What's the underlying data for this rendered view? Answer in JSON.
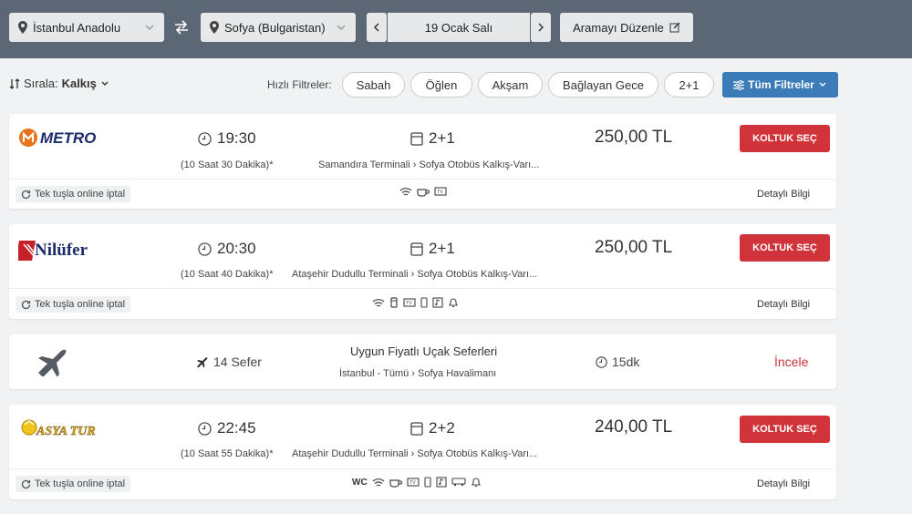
{
  "search": {
    "from": "İstanbul Anadolu",
    "to": "Sofya (Bulgaristan)",
    "date": "19 Ocak Salı",
    "edit_label": "Aramayı Düzenle"
  },
  "filters": {
    "sort_prefix": "Sırala:",
    "sort_value": "Kalkış",
    "quick_label": "Hızlı Filtreler:",
    "pills": [
      "Sabah",
      "Öğlen",
      "Akşam",
      "Bağlayan Gece",
      "2+1"
    ],
    "all_filters": "Tüm Filtreler"
  },
  "trips": [
    {
      "company": "METRO",
      "time": "19:30",
      "duration": "(10 Saat 30 Dakika)*",
      "seat": "2+1",
      "from_terminal": "Samandıra Terminali",
      "to_terminal": "Sofya Otobüs Kalkış-Varı...",
      "price": "250,00 TL",
      "button": "KOLTUK SEÇ",
      "cancel": "Tek tuşla online iptal",
      "details": "Detaylı Bilgi",
      "amenities": [
        "wifi-icon",
        "coffee-icon",
        "tv-icon"
      ]
    },
    {
      "company": "Nilüfer",
      "time": "20:30",
      "duration": "(10 Saat 40 Dakika)*",
      "seat": "2+1",
      "from_terminal": "Ataşehir Dudullu Terminali",
      "to_terminal": "Sofya Otobüs Kalkış-Varı...",
      "price": "250,00 TL",
      "button": "KOLTUK SEÇ",
      "cancel": "Tek tuşla online iptal",
      "details": "Detaylı Bilgi",
      "amenities": [
        "wifi-icon",
        "drink-icon",
        "tv-icon",
        "phone-icon",
        "music-icon",
        "bell-icon"
      ]
    },
    {
      "company": "ASYA TUR",
      "time": "22:45",
      "duration": "(10 Saat 55 Dakika)*",
      "seat": "2+2",
      "from_terminal": "Ataşehir Dudullu Terminali",
      "to_terminal": "Sofya Otobüs Kalkış-Varı...",
      "price": "240,00 TL",
      "button": "KOLTUK SEÇ",
      "cancel": "Tek tuşla online iptal",
      "details": "Detaylı Bilgi",
      "amenities": [
        "wc-icon",
        "wifi-icon",
        "coffee-icon",
        "tv-icon",
        "phone-icon",
        "music-icon",
        "bus-icon",
        "bell-icon"
      ]
    }
  ],
  "flight": {
    "count": "14 Sefer",
    "title": "Uygun Fiyatlı Uçak Seferleri",
    "from": "İstanbul - Tümü",
    "to": "Sofya Havalimanı",
    "duration": "15dk",
    "action": "İncele"
  },
  "colors": {
    "topbar": "#5b6774",
    "accent": "#3a7bb8",
    "cta": "#d0343a"
  }
}
